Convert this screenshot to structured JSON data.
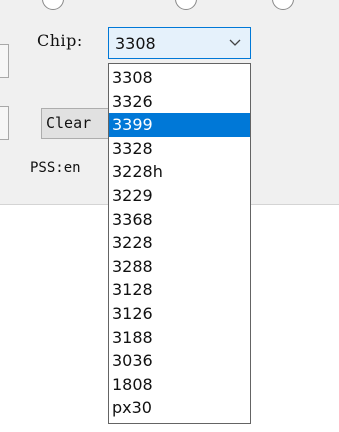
{
  "form": {
    "chip_label": "Chip:",
    "chip_value": "3308",
    "clear_label": "Clear",
    "pss_label": "PSS:en"
  },
  "dropdown": {
    "highlighted": "3399",
    "options": [
      "3308",
      "3326",
      "3399",
      "3328",
      "3228h",
      "3229",
      "3368",
      "3228",
      "3288",
      "3128",
      "3126",
      "3188",
      "3036",
      "1808",
      "px30"
    ]
  },
  "icons": {
    "dropdown_arrow": "chevron-down-icon"
  },
  "colors": {
    "accent": "#0078d7",
    "select_bg": "#e5f1fb",
    "panel_bg": "#f0f0f0"
  }
}
